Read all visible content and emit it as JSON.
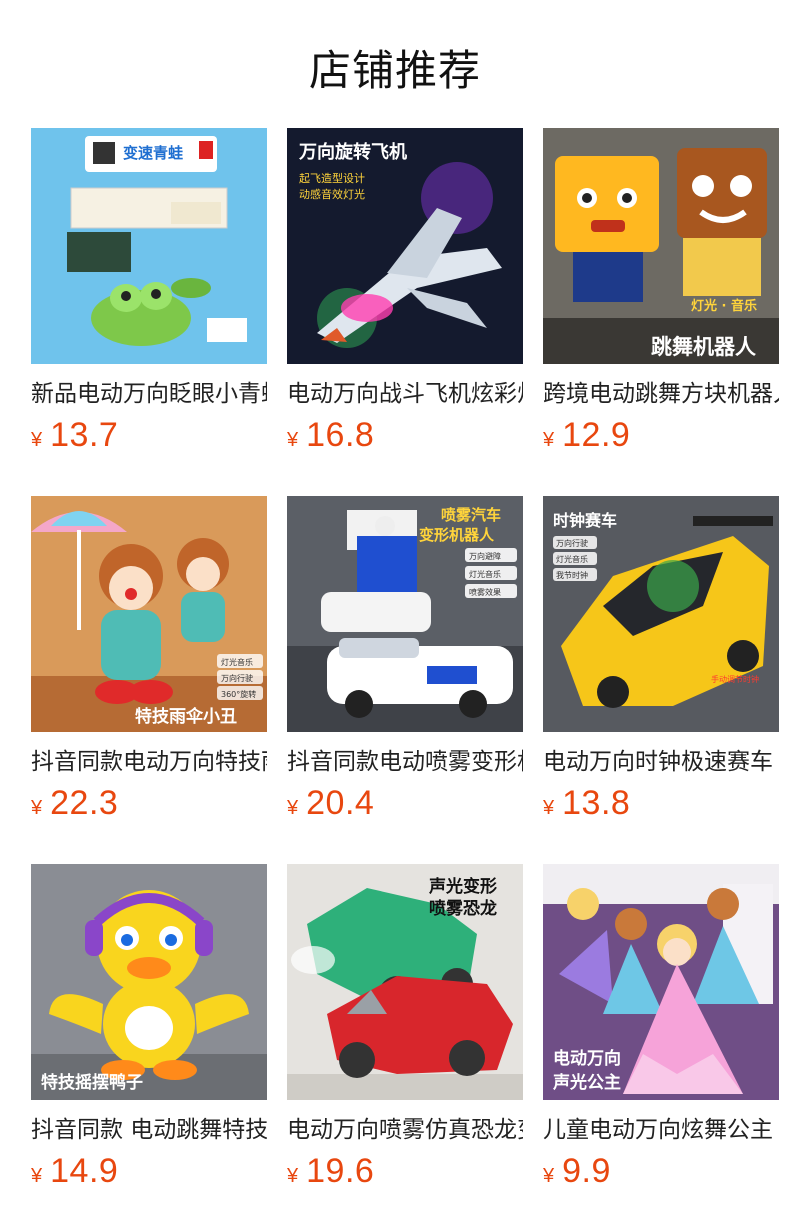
{
  "page": {
    "title": "店铺推荐",
    "currency": "¥",
    "price_color": "#e8470f"
  },
  "products": [
    {
      "title": "新品电动万向眨眼小青蛙",
      "price": "13.7",
      "image": {
        "theme": "frog-box",
        "text": [
          "变速青蛙"
        ],
        "bg": "#6fc3ec"
      }
    },
    {
      "title": "电动万向战斗飞机炫彩灯光",
      "price": "16.8",
      "image": {
        "theme": "jet",
        "text": [
          "万向旋转飞机",
          "起飞造型设计",
          "动感音效灯光"
        ],
        "bg": "#141a2e"
      }
    },
    {
      "title": "跨境电动跳舞方块机器人",
      "price": "12.9",
      "image": {
        "theme": "square-robots",
        "text": [
          "灯光 · 音乐",
          "跳舞机器人"
        ],
        "bg": "#6d6a63"
      }
    },
    {
      "title": "抖音同款电动万向特技雨伞小丑",
      "price": "22.3",
      "image": {
        "theme": "clown",
        "text": [
          "灯光音乐",
          "万向行驶",
          "360°旋转",
          "特技雨伞小丑"
        ],
        "bg": "#d99a5a"
      }
    },
    {
      "title": "抖音同款电动喷雾变形机器人",
      "price": "20.4",
      "image": {
        "theme": "police-robot",
        "text": [
          "喷雾汽车",
          "变形机器人",
          "万向避障",
          "灯光音乐",
          "喷雾效果"
        ],
        "bg": "#5b5f66"
      }
    },
    {
      "title": "电动万向时钟极速赛车",
      "price": "13.8",
      "image": {
        "theme": "race-car",
        "text": [
          "时钟赛车",
          "万向行驶",
          "灯光音乐",
          "我节时钟",
          "手动调节时钟"
        ],
        "bg": "#575a60"
      }
    },
    {
      "title": "抖音同款 电动跳舞特技摇摆鸭子",
      "price": "14.9",
      "image": {
        "theme": "duck",
        "text": [
          "特技摇摆鸭子"
        ],
        "bg": "#8a8d94"
      }
    },
    {
      "title": "电动万向喷雾仿真恐龙变形车",
      "price": "19.6",
      "image": {
        "theme": "dino-cars",
        "text": [
          "声光变形",
          "喷雾恐龙"
        ],
        "bg": "#e5e3df"
      }
    },
    {
      "title": "儿童电动万向炫舞公主",
      "price": "9.9",
      "image": {
        "theme": "princess",
        "text": [
          "电动万向",
          "声光公主"
        ],
        "bg": "#6f4e86"
      }
    }
  ]
}
